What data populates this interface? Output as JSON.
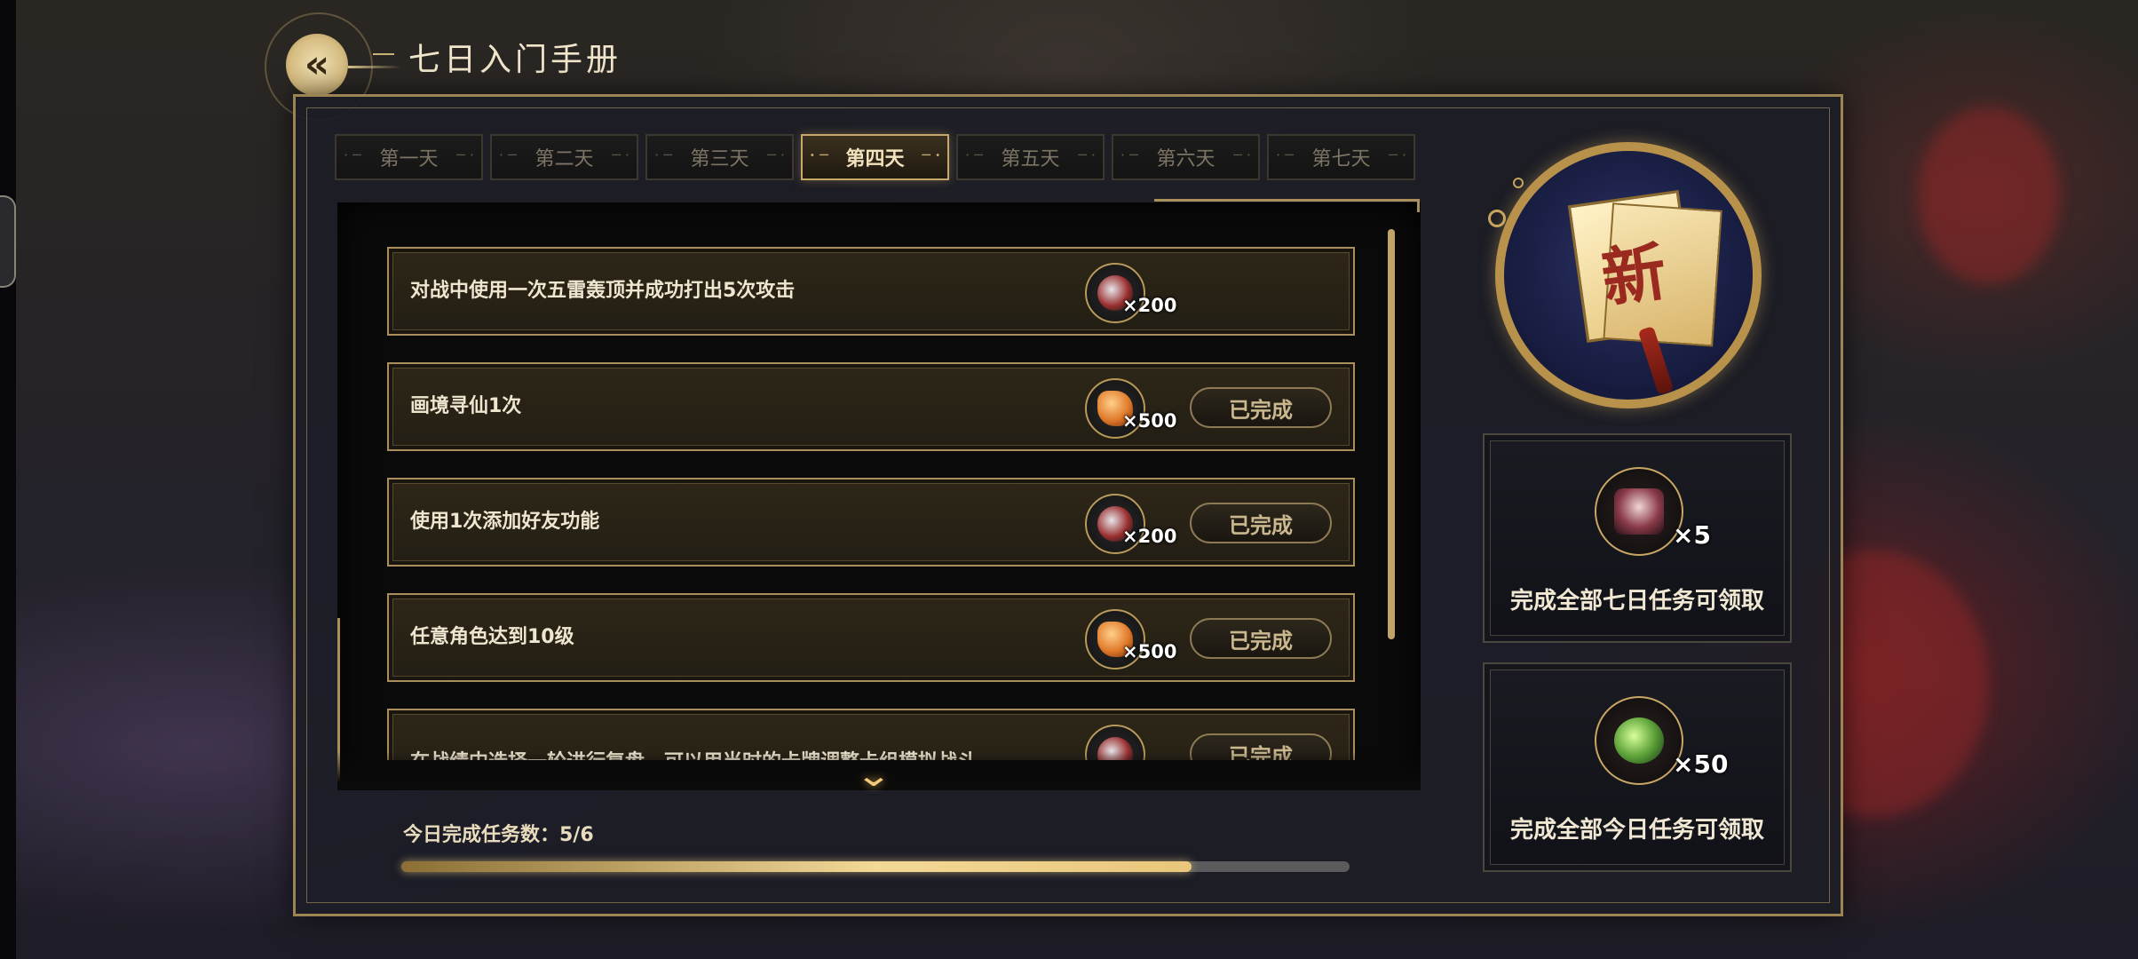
{
  "header": {
    "title": "七日入门手册",
    "back_icon": "back-arrow-icon"
  },
  "tabs": [
    {
      "label": "第一天",
      "active": false
    },
    {
      "label": "第二天",
      "active": false
    },
    {
      "label": "第三天",
      "active": false
    },
    {
      "label": "第四天",
      "active": true
    },
    {
      "label": "第五天",
      "active": false
    },
    {
      "label": "第六天",
      "active": false
    },
    {
      "label": "第七天",
      "active": false
    }
  ],
  "tasks": [
    {
      "text": "对战中使用一次五雷轰顶并成功打出5次攻击",
      "reward_icon": "silver-coin-icon",
      "reward_qty": "×200",
      "status": ""
    },
    {
      "text": "画境寻仙1次",
      "reward_icon": "amber-stone-icon",
      "reward_qty": "×500",
      "status": "已完成"
    },
    {
      "text": "使用1次添加好友功能",
      "reward_icon": "silver-coin-icon",
      "reward_qty": "×200",
      "status": "已完成"
    },
    {
      "text": "任意角色达到10级",
      "reward_icon": "amber-stone-icon",
      "reward_qty": "×500",
      "status": "已完成"
    },
    {
      "text": "在战绩中选择一轮进行复盘。可以用当时的卡牌调整卡组模拟战斗",
      "reward_icon": "silver-coin-icon",
      "reward_qty": "",
      "status": "已完成"
    }
  ],
  "progress": {
    "label": "今日完成任务数：5/6",
    "completed": 5,
    "total": 6
  },
  "emblem": {
    "char": "新"
  },
  "big_rewards": [
    {
      "icon": "treasure-chest-icon",
      "qty": "×5",
      "desc": "完成全部七日任务可领取"
    },
    {
      "icon": "jade-pendant-icon",
      "qty": "×50",
      "desc": "完成全部今日任务可领取"
    }
  ],
  "colors": {
    "gold": "#a88f5b",
    "accent": "#f3d896",
    "panel": "#0b0a0a"
  }
}
